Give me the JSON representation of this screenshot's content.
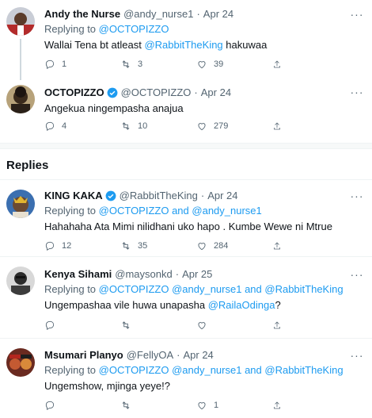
{
  "tweets": [
    {
      "name": "Andy the Nurse",
      "handle": "@andy_nurse1",
      "dot": "·",
      "date": "Apr 24",
      "replying_prefix": "Replying to",
      "replying_to": [
        "@OCTOPIZZO"
      ],
      "text_parts": [
        "Wallai Tena bt atleast ",
        "@RabbitTheKing",
        " hakuwaa"
      ],
      "replies": "1",
      "retweets": "3",
      "likes": "39"
    },
    {
      "name": "OCTOPIZZO",
      "handle": "@OCTOPIZZO",
      "dot": "·",
      "date": "Apr 24",
      "text": "Angekua ningempasha anajua",
      "replies": "4",
      "retweets": "10",
      "likes": "279"
    }
  ],
  "replies_section": {
    "title": "Replies"
  },
  "replies": [
    {
      "name": "KING KAKA",
      "handle": "@RabbitTheKing",
      "dot": "·",
      "date": "Apr 24",
      "replying_prefix": "Replying to",
      "replying_a": "@OCTOPIZZO",
      "and": " and ",
      "replying_b": "@andy_nurse1",
      "text": "Hahahaha Ata Mimi nilidhani uko hapo . Kumbe Wewe ni Mtrue",
      "replies": "12",
      "retweets": "35",
      "likes": "284"
    },
    {
      "name": "Kenya Sihami",
      "handle": "@maysonkd",
      "dot": "·",
      "date": "Apr 25",
      "replying_prefix": "Replying to",
      "replying_a": "@OCTOPIZZO @andy_nurse1",
      "and": " and ",
      "replying_b": "@RabbitTheKing",
      "text_parts": [
        "Ungempashaa vile huwa unapasha ",
        "@RailaOdinga",
        "?"
      ],
      "replies": "",
      "retweets": "",
      "likes": ""
    },
    {
      "name": "Msumari Planyo",
      "handle": "@FellyOA",
      "dot": "·",
      "date": "Apr 24",
      "replying_prefix": "Replying to",
      "replying_a": "@OCTOPIZZO @andy_nurse1",
      "and": " and ",
      "replying_b": "@RabbitTheKing",
      "text": "Ungemshow, mjinga yeye!?",
      "replies": "",
      "retweets": "",
      "likes": "1"
    }
  ],
  "icons": {
    "reply": "reply-icon",
    "retweet": "retweet-icon",
    "like": "like-icon",
    "share": "share-icon",
    "more": "more-icon",
    "verified": "verified-badge-icon"
  },
  "colors": {
    "link": "#1d9bf0",
    "muted": "#536471",
    "verified": "#1d9bf0"
  }
}
